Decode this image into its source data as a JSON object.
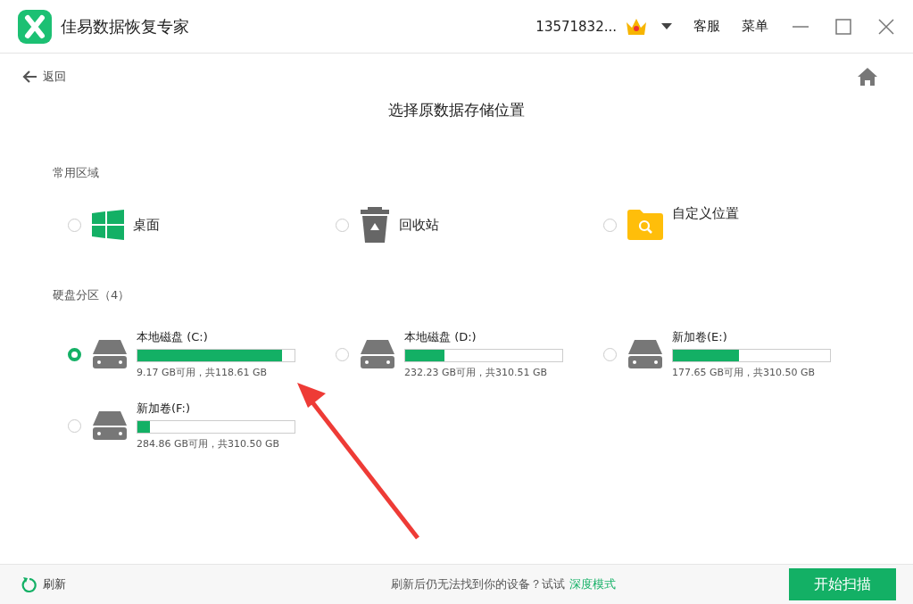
{
  "window": {
    "title": "佳易数据恢复专家",
    "account": "13571832...",
    "menu_items": [
      "客服",
      "菜单"
    ]
  },
  "nav": {
    "back": "返回"
  },
  "heading": "选择原数据存储位置",
  "common": {
    "title": "常用区域",
    "items": [
      {
        "kind": "desktop",
        "label": "桌面",
        "selected": false
      },
      {
        "kind": "recycle",
        "label": "回收站",
        "selected": false
      },
      {
        "kind": "custom",
        "label": "自定义位置",
        "selected": false
      }
    ]
  },
  "disks": {
    "title": "硬盘分区（4）",
    "items": [
      {
        "name": "本地磁盘 (C:)",
        "level": 0.92,
        "usage": "9.17 GB可用，共118.61 GB",
        "selected": true
      },
      {
        "name": "本地磁盘 (D:)",
        "level": 0.25,
        "usage": "232.23 GB可用，共310.51 GB",
        "selected": false
      },
      {
        "name": "新加卷(E:)",
        "level": 0.42,
        "usage": "177.65 GB可用，共310.50 GB",
        "selected": false
      },
      {
        "name": "新加卷(F:)",
        "level": 0.08,
        "usage": "284.86 GB可用，共310.50 GB",
        "selected": false
      }
    ]
  },
  "footer": {
    "refresh": "刷新",
    "hint": "刷新后仍无法找到你的设备？试试",
    "link": "深度模式",
    "button": "开始扫描"
  }
}
